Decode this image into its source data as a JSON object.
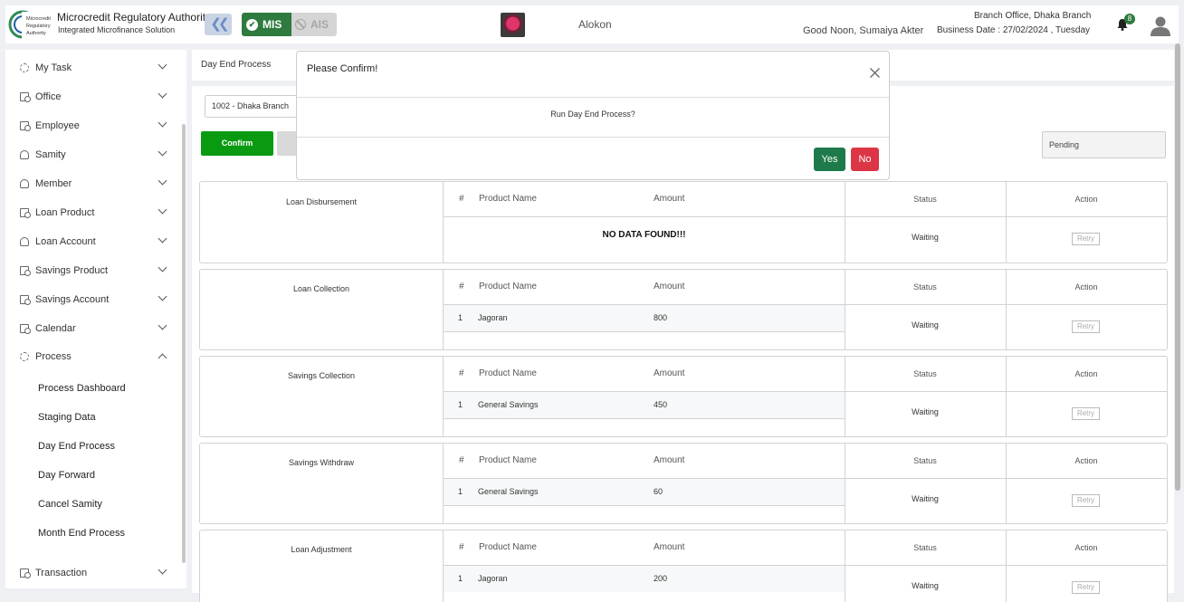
{
  "brand": {
    "title": "Microcredit Regulatory Authority",
    "subtitle": "Integrated Microfinance Solution",
    "logo_text": [
      "Microcredit",
      "Regulatory",
      "Authority"
    ]
  },
  "header": {
    "mis_label": "MIS",
    "ais_label": "AIS",
    "org_name": "Alokon",
    "greeting": "Good Noon, Sumaiya Akter",
    "branch_office": "Branch Office, Dhaka Branch",
    "business_date": "Business Date : 27/02/2024 , Tuesday",
    "notification_count": "8",
    "accent_color": "#2f7a3e"
  },
  "sidebar": {
    "items": [
      {
        "label": "My Task",
        "icon": "circle-icon"
      },
      {
        "label": "Office",
        "icon": "document-icon"
      },
      {
        "label": "Employee",
        "icon": "document-icon"
      },
      {
        "label": "Samity",
        "icon": "people-icon"
      },
      {
        "label": "Member",
        "icon": "people-icon"
      },
      {
        "label": "Loan Product",
        "icon": "document-icon"
      },
      {
        "label": "Loan Account",
        "icon": "people-icon"
      },
      {
        "label": "Savings Product",
        "icon": "document-icon"
      },
      {
        "label": "Savings Account",
        "icon": "document-icon"
      },
      {
        "label": "Calendar",
        "icon": "document-icon"
      },
      {
        "label": "Process",
        "icon": "circle-icon",
        "expanded": true
      },
      {
        "label": "Transaction",
        "icon": "document-icon"
      }
    ],
    "process_subitems": [
      "Process Dashboard",
      "Staging Data",
      "Day End Process",
      "Day Forward",
      "Cancel Samity",
      "Month End Process"
    ]
  },
  "page": {
    "title": "Day End Process",
    "branch_select": "1002 - Dhaka Branch",
    "confirm_label": "Confirm",
    "status_value": "Pending"
  },
  "table_headers": {
    "num": "#",
    "product": "Product Name",
    "amount": "Amount",
    "status": "Status",
    "action": "Action"
  },
  "sections": [
    {
      "title": "Loan Disbursement",
      "no_data": "NO DATA FOUND!!!",
      "rows": [],
      "status": "Waiting",
      "action": "Retry"
    },
    {
      "title": "Loan Collection",
      "rows": [
        {
          "num": "1",
          "product": "Jagoran",
          "amount": "800"
        }
      ],
      "status": "Waiting",
      "action": "Retry"
    },
    {
      "title": "Savings Collection",
      "rows": [
        {
          "num": "1",
          "product": "General Savings",
          "amount": "450"
        }
      ],
      "status": "Waiting",
      "action": "Retry"
    },
    {
      "title": "Savings Withdraw",
      "rows": [
        {
          "num": "1",
          "product": "General Savings",
          "amount": "60"
        }
      ],
      "status": "Waiting",
      "action": "Retry"
    },
    {
      "title": "Loan Adjustment",
      "rows": [
        {
          "num": "1",
          "product": "Jagoran",
          "amount": "200"
        }
      ],
      "status": "Waiting",
      "action": "Retry"
    }
  ],
  "modal": {
    "title": "Please Confirm!",
    "message": "Run Day End Process?",
    "yes_label": "Yes",
    "no_label": "No"
  }
}
